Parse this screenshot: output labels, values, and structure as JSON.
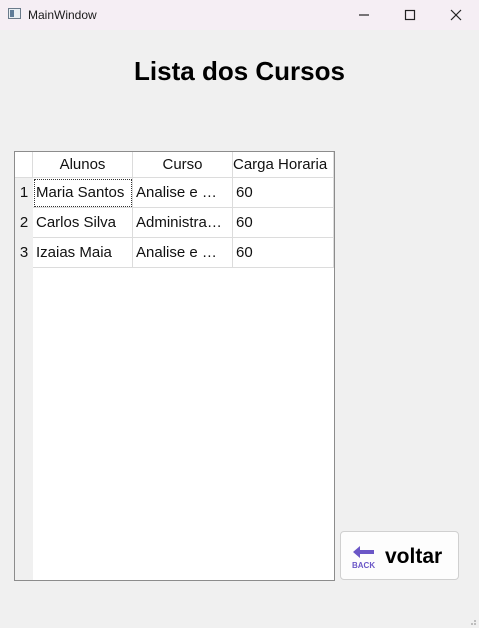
{
  "window": {
    "title": "MainWindow",
    "controls": [
      "minimize-icon",
      "maximize-icon",
      "close-icon"
    ]
  },
  "page": {
    "title": "Lista dos Cursos"
  },
  "table": {
    "columns": [
      "Alunos",
      "Curso",
      "Carga Horaria"
    ],
    "rows": [
      {
        "index": "1",
        "cells": [
          "Maria Santos",
          "Analise e …",
          "60"
        ]
      },
      {
        "index": "2",
        "cells": [
          "Carlos Silva",
          "Administra…",
          "60"
        ]
      },
      {
        "index": "3",
        "cells": [
          "Izaias Maia",
          "Analise e …",
          "60"
        ]
      }
    ]
  },
  "back_button": {
    "label": "voltar",
    "icon": "back-arrow-icon",
    "icon_text": "BACK",
    "icon_color": "#6b57c7"
  }
}
